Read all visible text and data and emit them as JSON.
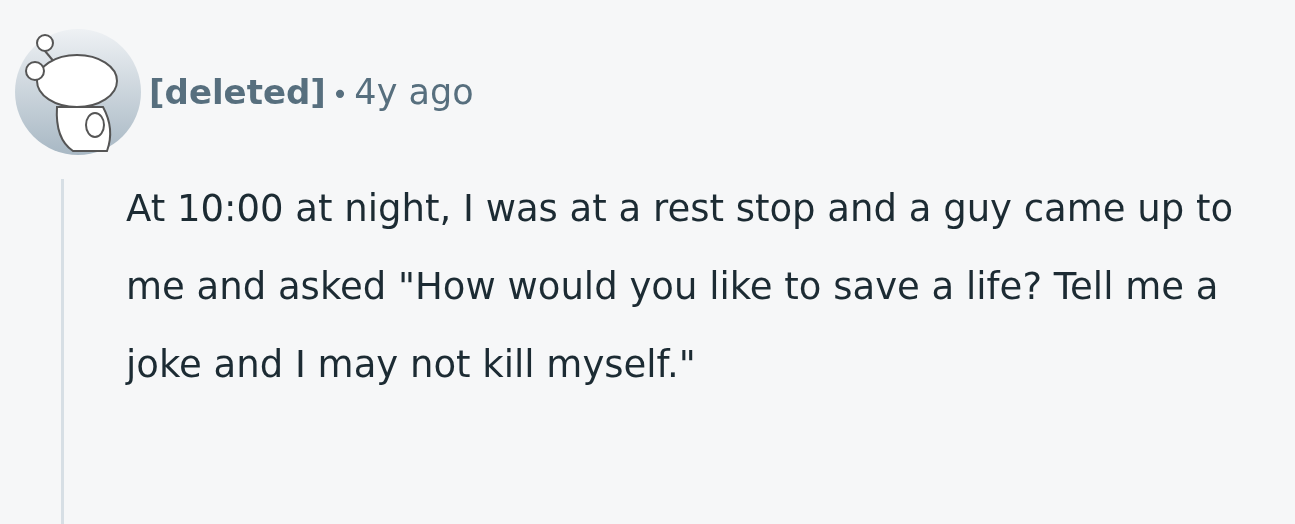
{
  "comment": {
    "author": "[deleted]",
    "separator": "•",
    "time": "4y ago",
    "body": "At 10:00 at night, I was at a rest stop and a guy came up to me and asked \"How would you like to save a life? Tell me a joke and I may not kill myself.\""
  }
}
